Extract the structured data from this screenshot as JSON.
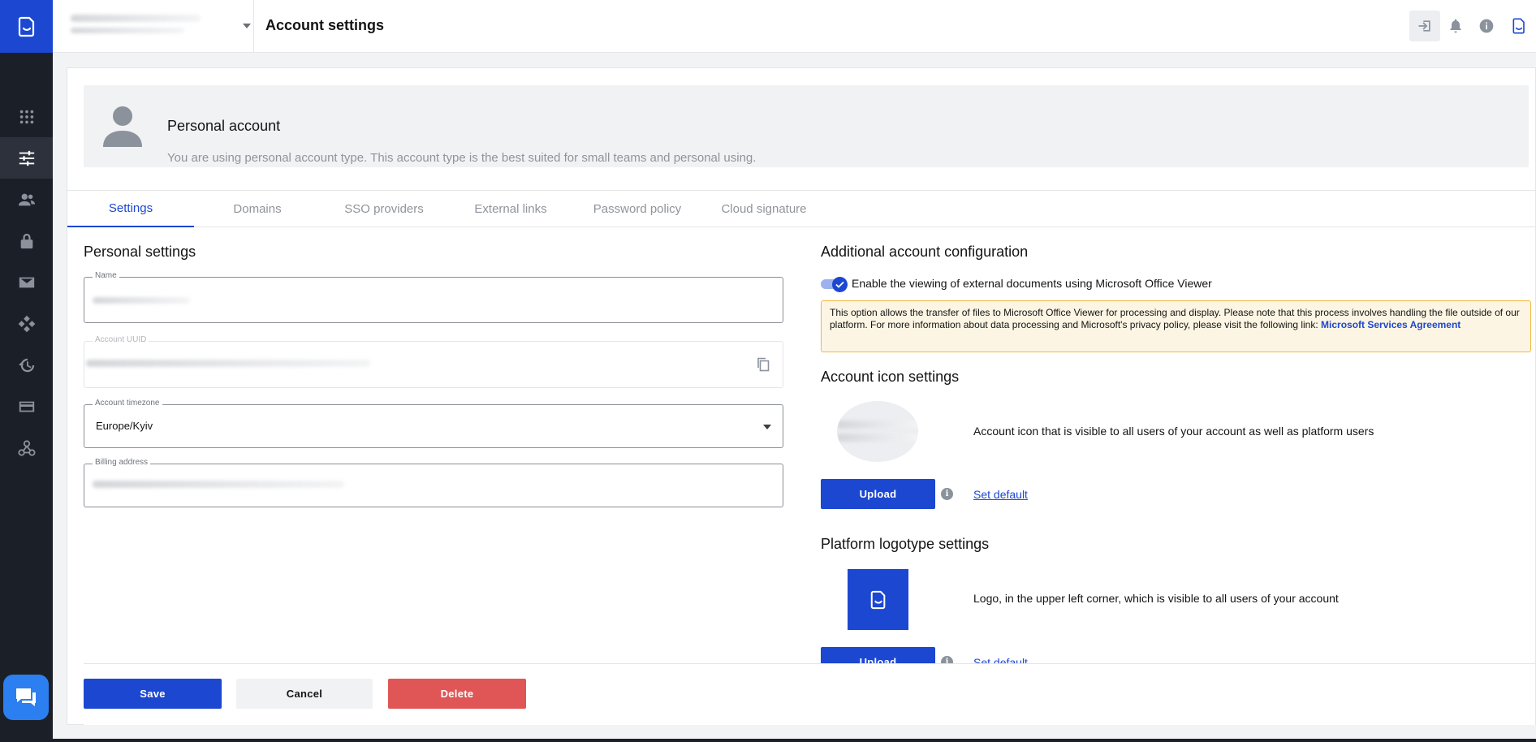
{
  "topbar": {
    "title": "Account settings"
  },
  "sidebar": {
    "items": [
      {
        "icon": "grid-icon"
      },
      {
        "icon": "sliders-icon",
        "active": true
      },
      {
        "icon": "users-icon"
      },
      {
        "icon": "lock-icon"
      },
      {
        "icon": "mail-icon"
      },
      {
        "icon": "workflow-icon"
      },
      {
        "icon": "history-icon"
      },
      {
        "icon": "credit-card-icon"
      },
      {
        "icon": "webhook-icon"
      }
    ]
  },
  "account": {
    "title": "Personal account",
    "subtitle": "You are using personal account type. This account type is the best suited for small teams and personal using."
  },
  "tabs": [
    {
      "label": "Settings",
      "active": true
    },
    {
      "label": "Domains"
    },
    {
      "label": "SSO providers"
    },
    {
      "label": "External links"
    },
    {
      "label": "Password policy"
    },
    {
      "label": "Cloud signature"
    }
  ],
  "personal": {
    "title": "Personal settings",
    "name_label": "Name",
    "uuid_label": "Account UUID",
    "timezone_label": "Account timezone",
    "timezone_value": "Europe/Kyiv",
    "billing_label": "Billing address"
  },
  "additional": {
    "title": "Additional account configuration",
    "toggle_label": "Enable the viewing of external documents using Microsoft Office Viewer",
    "toggle_on": true,
    "notice_text": "This option allows the transfer of files to Microsoft Office Viewer for processing and display. Please note that this process involves handling the file outside of our platform. For more information about data processing and Microsoft's privacy policy, please visit the following link: ",
    "notice_link": "Microsoft Services Agreement"
  },
  "icon_settings": {
    "title": "Account icon settings",
    "description": "Account icon that is visible to all users of your account as well as platform users",
    "upload_label": "Upload",
    "default_label": "Set default"
  },
  "logo_settings": {
    "title": "Platform logotype settings",
    "description": "Logo, in the upper left corner, which is visible to all users of your account",
    "upload_label": "Upload",
    "default_label": "Set default"
  },
  "footer": {
    "save_label": "Save",
    "cancel_label": "Cancel",
    "delete_label": "Delete"
  },
  "colors": {
    "brand": "#1c47d1",
    "sidebar": "#1b1f27",
    "danger": "#e05555",
    "notice_bg": "#fdf5e3",
    "notice_border": "#f0b840"
  }
}
